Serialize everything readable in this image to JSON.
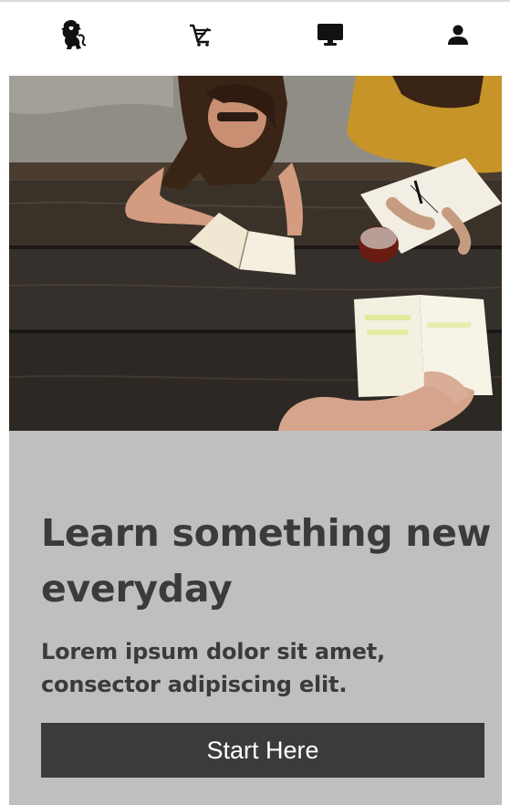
{
  "navbar": {
    "items": [
      {
        "icon": "lion-logo-icon"
      },
      {
        "icon": "shopping-cart-icon"
      },
      {
        "icon": "desktop-icon"
      },
      {
        "icon": "user-icon"
      }
    ]
  },
  "hero": {
    "image": "students-reading-at-picnic-table-photo",
    "title": "Learn something new everyday",
    "subtitle": "Lorem ipsum dolor sit amet, consector adipiscing elit.",
    "cta_label": "Start Here"
  },
  "colors": {
    "panel_background": "#bfbfbf",
    "text": "#3b3b3b",
    "button_background": "#3b3b3b",
    "button_text": "#ffffff"
  }
}
